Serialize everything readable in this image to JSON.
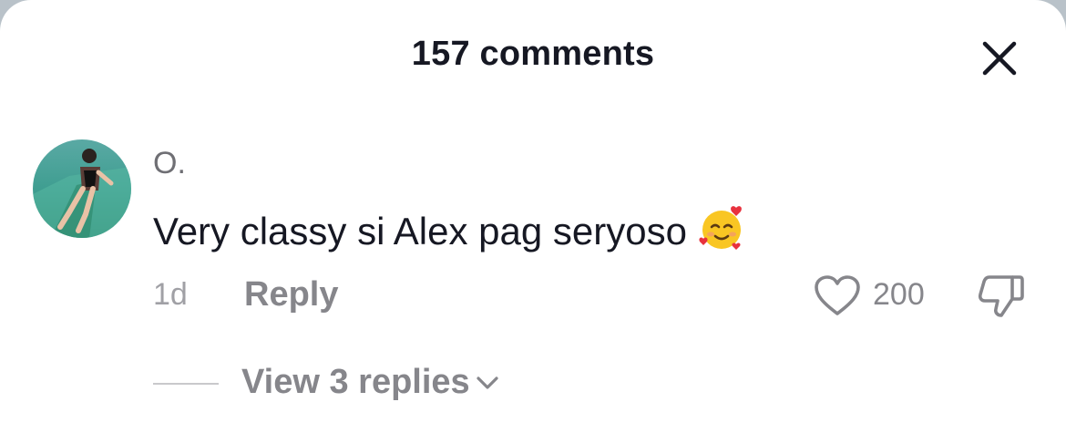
{
  "header": {
    "title": "157 comments",
    "close_icon": "close-icon"
  },
  "comment": {
    "username": "O.",
    "text": "Very classy si Alex pag seryoso",
    "emoji": "smiling-face-with-hearts",
    "time": "1d",
    "reply_label": "Reply",
    "like_count": "200",
    "like_icon": "heart-icon",
    "dislike_icon": "thumbs-down-icon",
    "view_replies_label": "View 3 replies",
    "view_replies_icon": "chevron-down-icon"
  },
  "colors": {
    "primary_text": "#161823",
    "secondary_text": "#86868b",
    "background": "#ffffff"
  }
}
